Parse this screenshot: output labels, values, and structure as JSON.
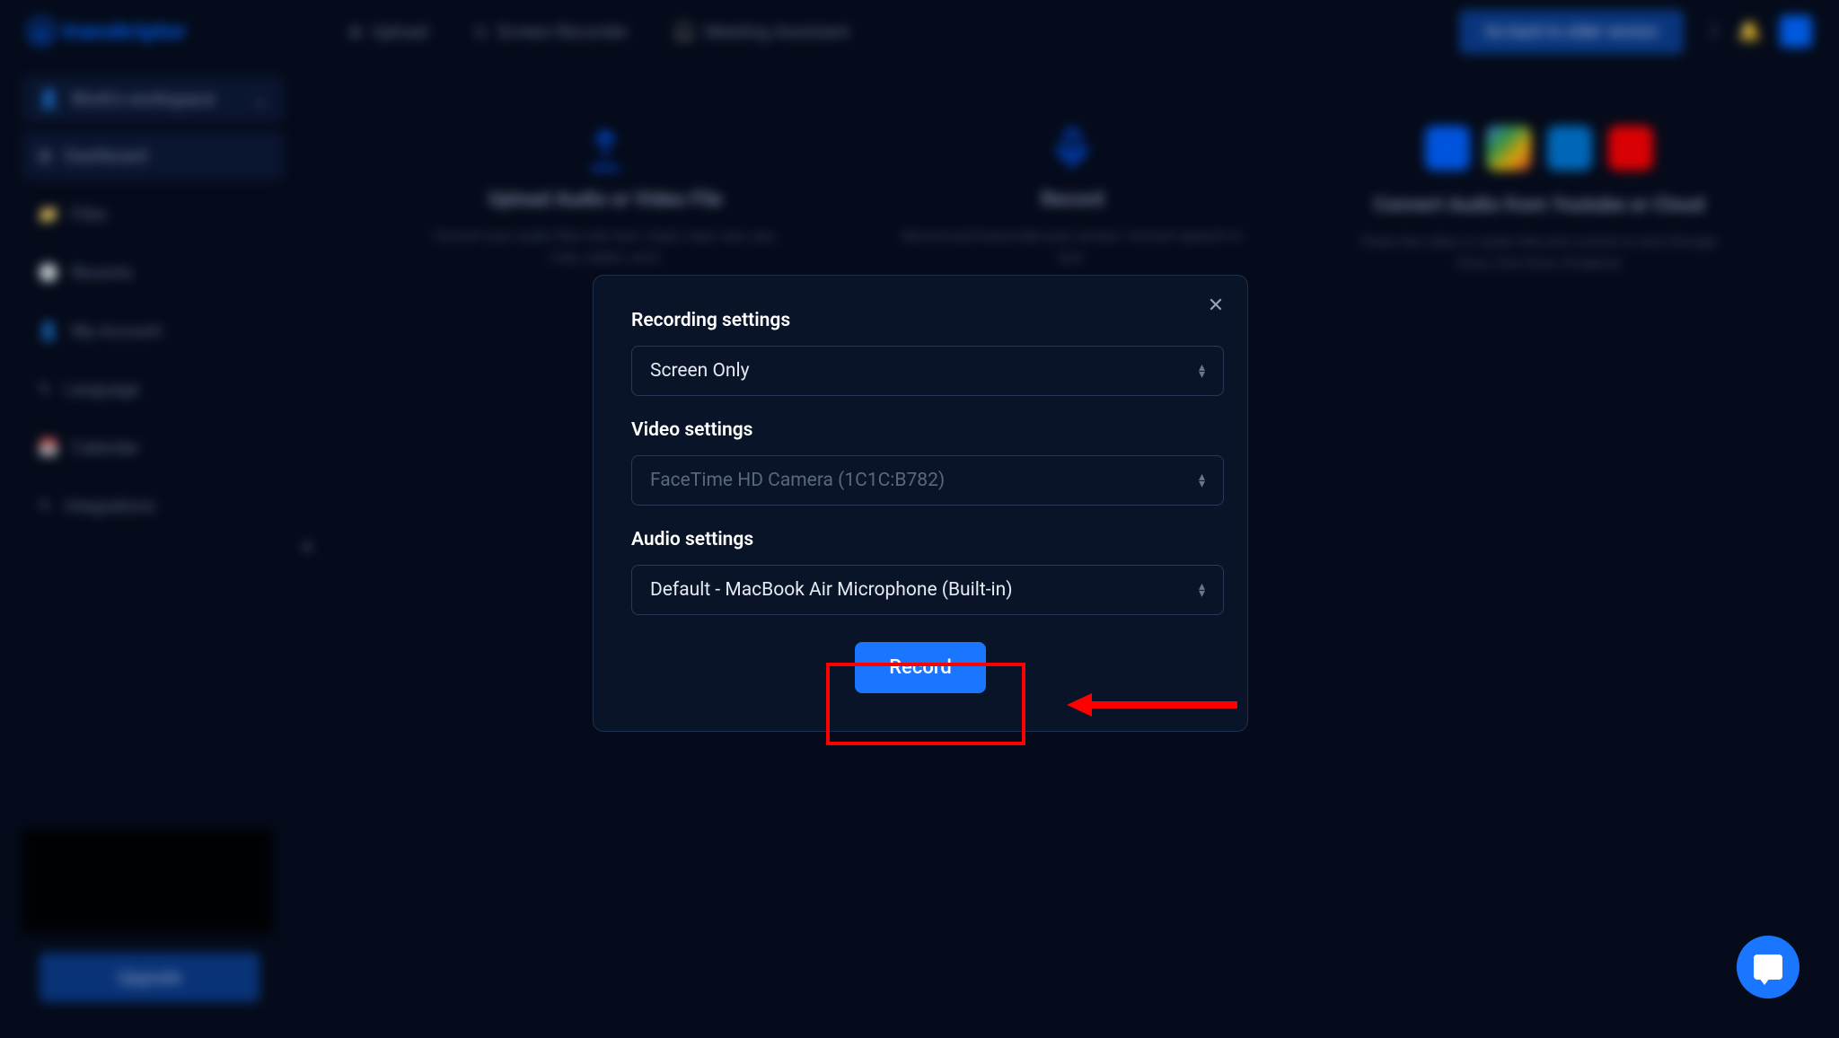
{
  "header": {
    "logo_text": "transkriptor",
    "nav_upload": "Upload",
    "nav_recorder": "Screen Recorder",
    "nav_meeting": "Meeting Assistant",
    "cta_text": "Go back to older version"
  },
  "sidebar": {
    "workspace": "Work's workspace",
    "items": [
      {
        "label": "Dashboard",
        "active": true
      },
      {
        "label": "Files",
        "active": false
      },
      {
        "label": "Recents",
        "active": false
      },
      {
        "label": "My Account",
        "active": false
      },
      {
        "label": "Language",
        "active": false
      },
      {
        "label": "Calendar",
        "active": false
      },
      {
        "label": "Integrations",
        "active": false
      }
    ],
    "upgrade": "Upgrade"
  },
  "content": {
    "card_upload": {
      "title": "Upload Audio or Video File",
      "desc": "Convert your audio files into text. (mp3, mp4, wav, aac, m4a, webm, amr)"
    },
    "card_record": {
      "title": "Record",
      "desc": "Record and transcribe your screen. Convert speech to text."
    },
    "card_cloud": {
      "title": "Convert Audio from Youtube or Cloud",
      "desc": "Paste the video or audio link and convert to text (Google Drive, One Drive, Dropbox)"
    }
  },
  "modal": {
    "section_recording": "Recording settings",
    "recording_value": "Screen Only",
    "section_video": "Video settings",
    "video_value": "FaceTime HD Camera (1C1C:B782)",
    "section_audio": "Audio settings",
    "audio_value": "Default - MacBook Air Microphone (Built-in)",
    "record_button": "Record"
  }
}
